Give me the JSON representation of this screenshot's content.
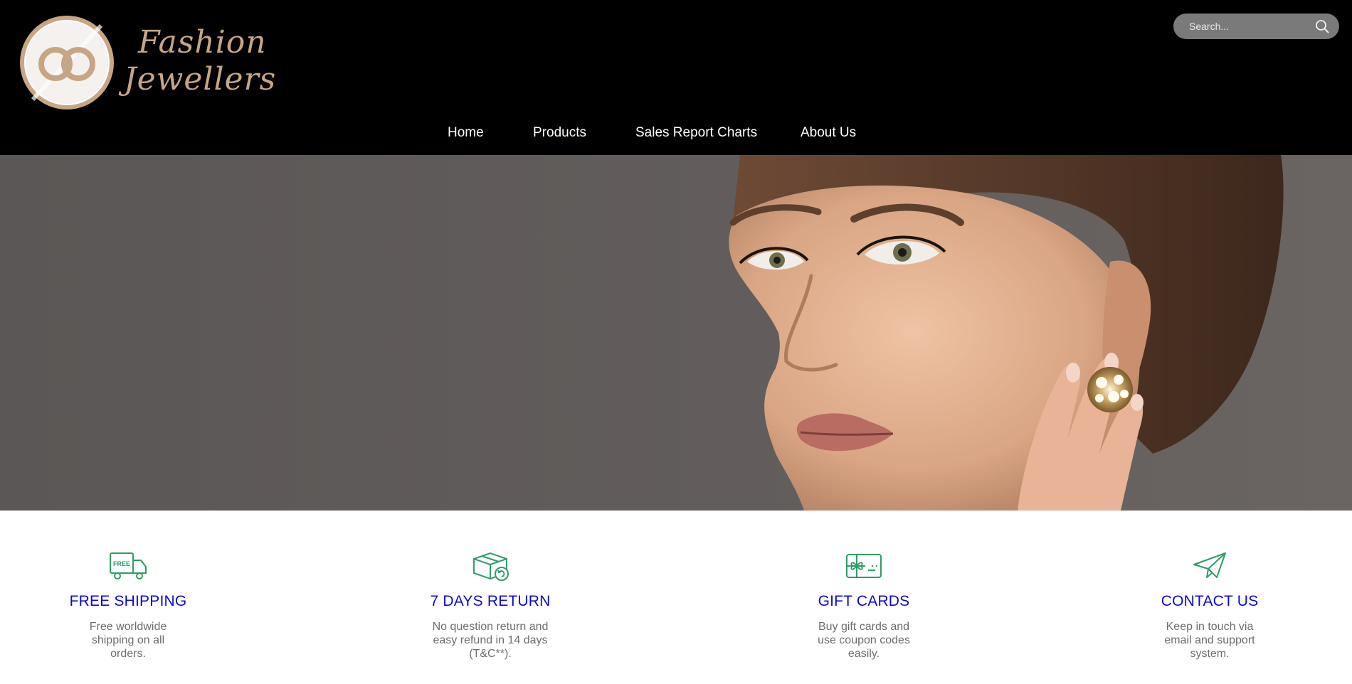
{
  "brand": {
    "logo_line1": "Fashion",
    "logo_line2": "Jewellers",
    "logo_color": "#c7a684"
  },
  "search": {
    "placeholder": "Search...",
    "value": "",
    "icon": "search-icon"
  },
  "nav": {
    "items": [
      {
        "label": "Home"
      },
      {
        "label": "Products"
      },
      {
        "label": "Sales Report Charts"
      },
      {
        "label": "About Us"
      }
    ]
  },
  "hero": {
    "image": "model-with-gold-earring-photo",
    "background_color": "#5e5958"
  },
  "features": [
    {
      "icon": "delivery-truck-icon",
      "icon_text": "FREE",
      "title": "FREE SHIPPING",
      "description": "Free worldwide shipping on all orders."
    },
    {
      "icon": "return-box-icon",
      "title": "7 DAYS RETURN",
      "description": "No question return and easy refund in 14 days (T&C**)."
    },
    {
      "icon": "gift-card-icon",
      "title": "GIFT CARDS",
      "description": "Buy gift cards and use coupon codes easily."
    },
    {
      "icon": "paper-plane-icon",
      "title": "CONTACT US",
      "description": "Keep in touch via email and support system."
    }
  ],
  "colors": {
    "header_bg": "#000000",
    "feature_title": "#0a0ad8",
    "feature_icon": "#2e9e63",
    "feature_text": "#6e6e6e"
  }
}
